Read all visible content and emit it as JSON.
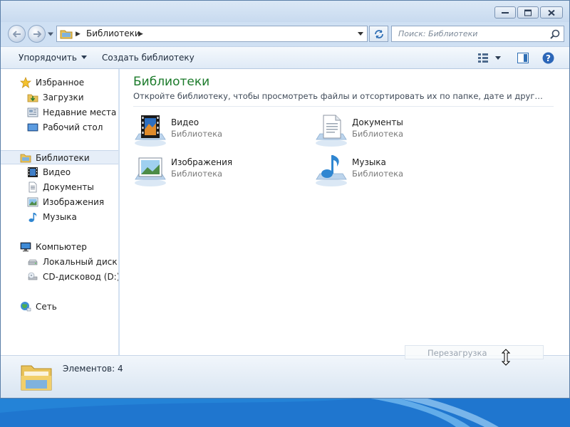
{
  "window": {
    "title_buttons": [
      "minimize-icon",
      "maximize-icon",
      "close-icon"
    ]
  },
  "address": {
    "crumbs": [
      "Библиотеки"
    ]
  },
  "search": {
    "placeholder": "Поиск: Библиотеки"
  },
  "toolbar": {
    "organize_label": "Упорядочить",
    "create_library_label": "Создать библиотеку"
  },
  "sidebar": {
    "favorites": {
      "label": "Избранное",
      "items": [
        {
          "label": "Загрузки",
          "icon": "downloads-folder-icon"
        },
        {
          "label": "Недавние места",
          "icon": "recent-places-icon"
        },
        {
          "label": "Рабочий стол",
          "icon": "desktop-icon"
        }
      ]
    },
    "libraries": {
      "label": "Библиотеки",
      "items": [
        {
          "label": "Видео",
          "icon": "video-library-icon"
        },
        {
          "label": "Документы",
          "icon": "documents-library-icon"
        },
        {
          "label": "Изображения",
          "icon": "pictures-library-icon"
        },
        {
          "label": "Музыка",
          "icon": "music-library-icon"
        }
      ]
    },
    "computer": {
      "label": "Компьютер",
      "items": [
        {
          "label": "Локальный диск (C",
          "icon": "hard-drive-icon"
        },
        {
          "label": "CD-дисковод (D:) vi",
          "icon": "cd-drive-icon"
        }
      ]
    },
    "network": {
      "label": "Сеть"
    }
  },
  "main": {
    "title": "Библиотеки",
    "description": "Откройте библиотеку, чтобы просмотреть файлы и отсортировать их по папке, дате и другим свойств...",
    "libraries": [
      {
        "name": "Видео",
        "type": "Библиотека"
      },
      {
        "name": "Документы",
        "type": "Библиотека"
      },
      {
        "name": "Изображения",
        "type": "Библиотека"
      },
      {
        "name": "Музыка",
        "type": "Библиотека"
      }
    ]
  },
  "status": {
    "count_text": "Элементов: 4"
  },
  "overlay": {
    "ghost_label": "Перезагрузка"
  },
  "colors": {
    "title_green": "#1b7a2a",
    "selection": "#e6eef8",
    "taskbar": "#1f76cf"
  }
}
